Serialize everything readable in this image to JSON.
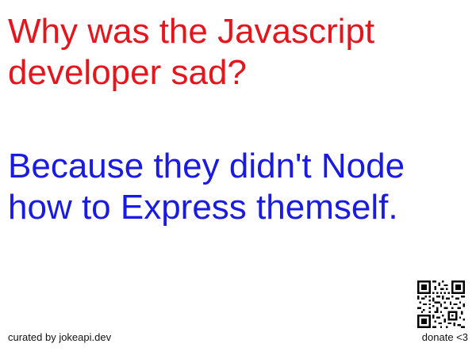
{
  "joke": {
    "setup": "Why was the Javascript developer sad?",
    "punchline": "Because they didn't Node how to Express themself."
  },
  "footer": {
    "credit": "curated by jokeapi.dev",
    "donate": "donate <3"
  },
  "colors": {
    "setup": "#e8141c",
    "punchline": "#1a1ae6",
    "background": "#ffffff",
    "footer_text": "#111111"
  },
  "icons": {
    "qr": "qr-code-icon"
  }
}
